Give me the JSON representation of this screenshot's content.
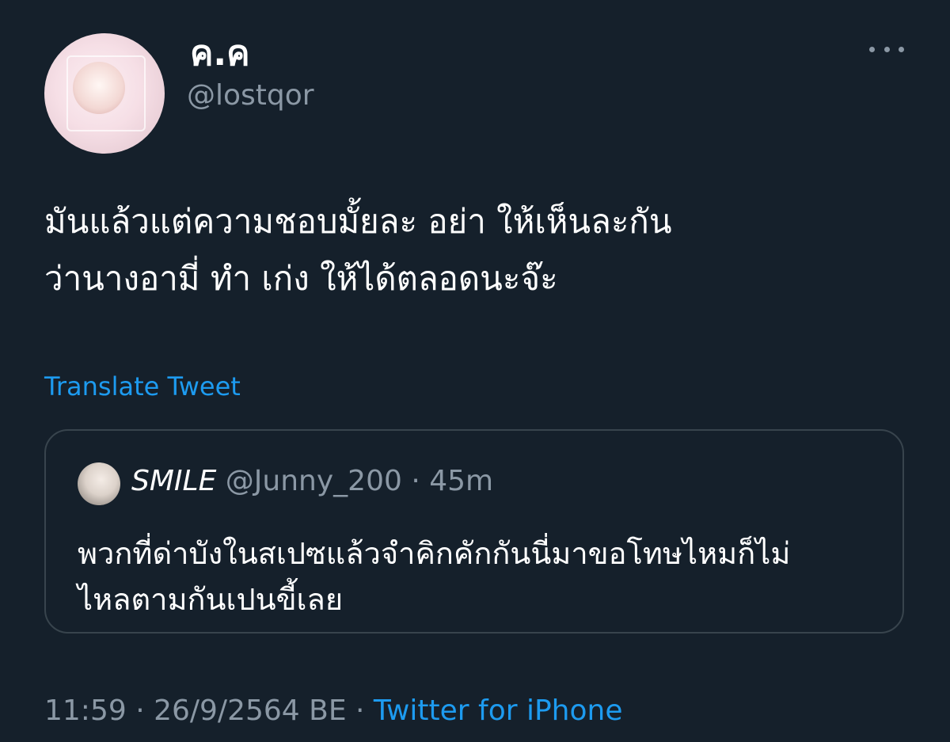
{
  "author": {
    "display_name": "ค.ค",
    "handle": "@lostqor"
  },
  "tweet": {
    "text": "มันแล้วแต่ความชอบมั้ยละ อย่า ให้เห็นละกัน\nว่านางอามี่ ทำ เก่ง ให้ได้ตลอดนะจ๊ะ",
    "translate_label": "Translate Tweet"
  },
  "quoted_tweet": {
    "display_name": "SMILE",
    "handle": "@Junny_200",
    "separator": " · ",
    "time": "45m",
    "text": "พวกที่ด่าบังในสเปซแล้วจำคิกคักกันนี่มาขอโทษไหมก็ไม่\nไหลตามกันเปนขี้เลย"
  },
  "footer": {
    "time": "11:59",
    "separator": " · ",
    "date": "26/9/2564 BE",
    "source": "Twitter for iPhone"
  },
  "colors": {
    "background": "#15202b",
    "accent": "#1d9bf0",
    "secondary_text": "#8b98a5",
    "border": "#38444d"
  },
  "icons": {
    "more": "more-horizontal-icon"
  }
}
